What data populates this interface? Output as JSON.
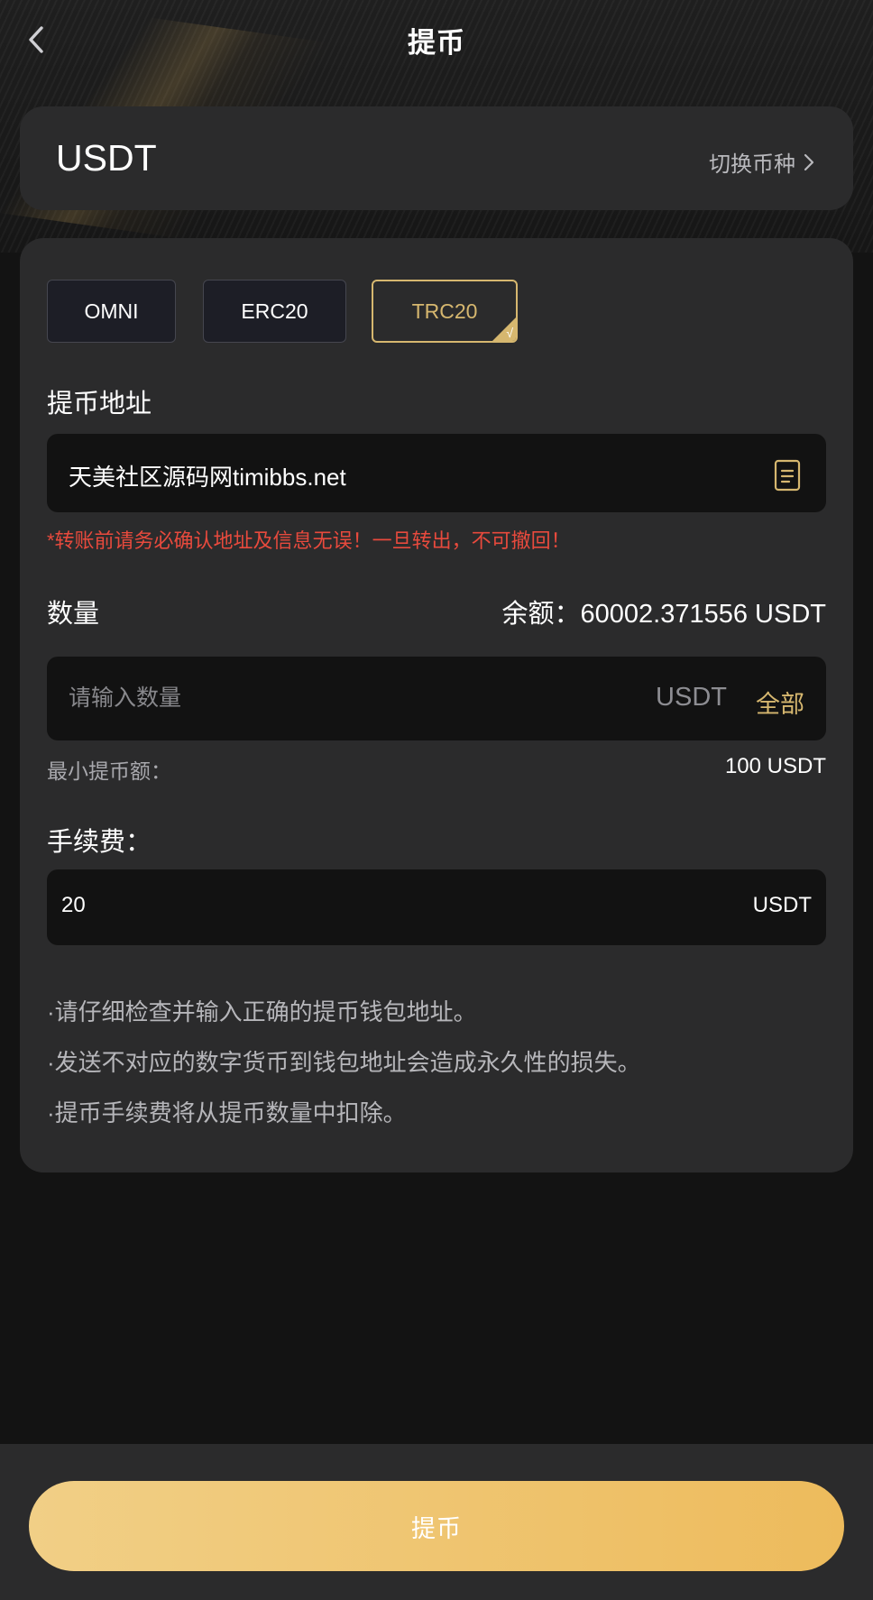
{
  "header": {
    "title": "提币"
  },
  "coin": {
    "name": "USDT",
    "switch_label": "切换币种"
  },
  "chains": [
    {
      "label": "OMNI",
      "selected": false
    },
    {
      "label": "ERC20",
      "selected": false
    },
    {
      "label": "TRC20",
      "selected": true
    }
  ],
  "check_mark": "√",
  "address": {
    "label": "提币地址",
    "value": "天美社区源码网timibbs.net",
    "warning": "*转账前请务必确认地址及信息无误！一旦转出，不可撤回！"
  },
  "amount": {
    "label": "数量",
    "balance": "余额：60002.371556 USDT",
    "placeholder": "请输入数量",
    "unit": "USDT",
    "all_label": "全部",
    "min_label": "最小提币额：",
    "min_value": "100 USDT"
  },
  "fee": {
    "label": "手续费：",
    "value": "20",
    "unit": "USDT"
  },
  "notes": [
    "·请仔细检查并输入正确的提币钱包地址。",
    "·发送不对应的数字货币到钱包地址会造成永久性的损失。",
    "·提币手续费将从提币数量中扣除。"
  ],
  "submit": {
    "label": "提币"
  },
  "colors": {
    "accent": "#d6b76f",
    "warning": "#e84a3d",
    "button_gradient_start": "#f1cf86",
    "button_gradient_end": "#edbb5c"
  }
}
